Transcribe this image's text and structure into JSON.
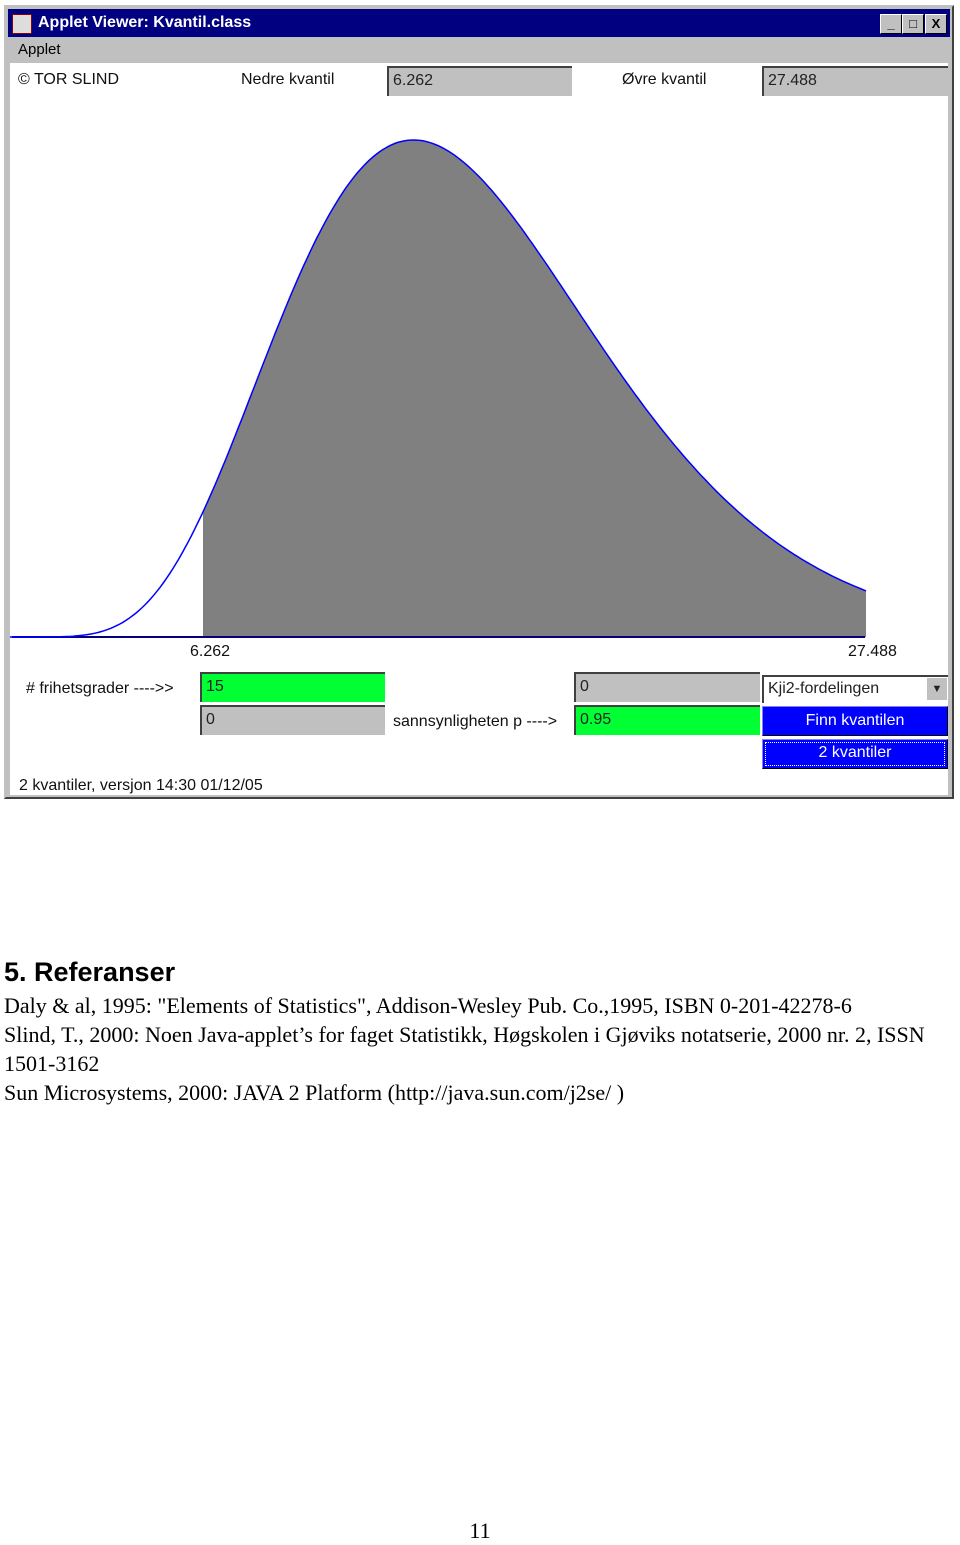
{
  "window": {
    "title": "Applet Viewer: Kvantil.class",
    "menu": "Applet",
    "minimize": "_",
    "maximize": "□",
    "close": "X"
  },
  "applet": {
    "copyright": "© TOR SLIND",
    "lower_label": "Nedre kvantil",
    "lower_value": "6.262",
    "upper_label": "Øvre kvantil",
    "upper_value": "27.488",
    "axis_lower": "6.262",
    "axis_upper": "27.488",
    "df_label": "# frihetsgrader ---->>",
    "df_value": "15",
    "second_field": "0",
    "p_label": "sannsynligheten p ---->",
    "p_value": "0.95",
    "top_right_field": "0",
    "distribution": "Kji2-fordelingen",
    "find_button": "Finn kvantilen",
    "two_button": "2 kvantiler",
    "status": "2 kvantiler, versjon 14:30 01/12/05",
    "curve": {
      "distribution": "chi-square",
      "df": 15,
      "shaded_from": 6.262,
      "shaded_to": 27.488,
      "fill": "#808080",
      "line": "#0000ff"
    }
  },
  "doc": {
    "heading": "5. Referanser",
    "refs": [
      "Daly & al, 1995: \"Elements of Statistics\", Addison-Wesley Pub. Co.,1995, ISBN  0-201-42278-6",
      "Slind, T., 2000: Noen Java-applet’s for faget Statistikk, Høgskolen i Gjøviks notatserie, 2000 nr. 2, ISSN 1501-3162",
      "Sun Microsystems, 2000: JAVA 2 Platform (http://java.sun.com/j2se/ )"
    ],
    "page_number": "11"
  }
}
